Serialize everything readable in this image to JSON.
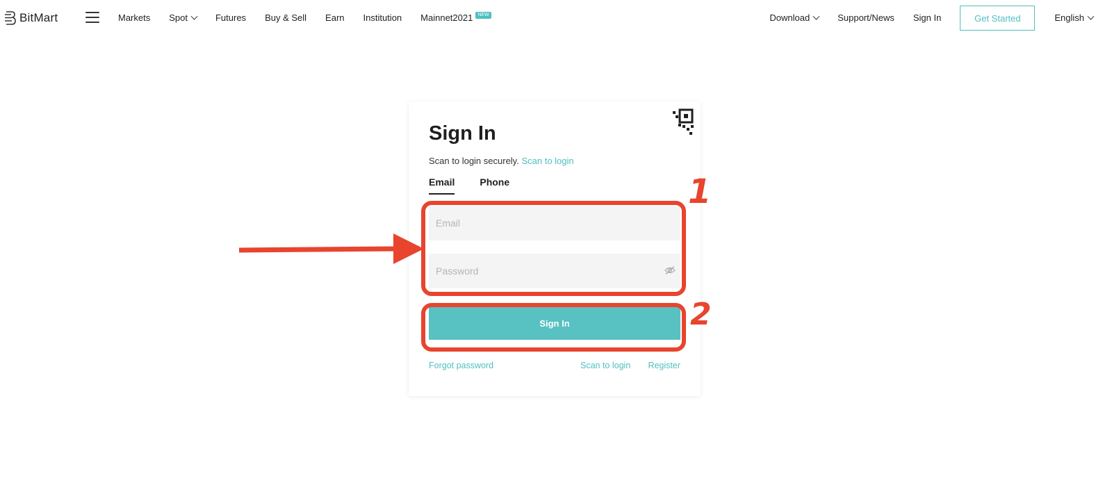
{
  "header": {
    "brand": "BitMart",
    "nav_left": [
      {
        "label": "Markets"
      },
      {
        "label": "Spot",
        "dropdown": true
      },
      {
        "label": "Futures"
      },
      {
        "label": "Buy & Sell"
      },
      {
        "label": "Earn"
      },
      {
        "label": "Institution"
      },
      {
        "label": "Mainnet2021",
        "badge": "NEW"
      }
    ],
    "nav_right": {
      "download": "Download",
      "support": "Support/News",
      "sign_in": "Sign In",
      "get_started": "Get Started",
      "language": "English"
    }
  },
  "signin": {
    "title": "Sign In",
    "scan_prefix": "Scan to login securely.",
    "scan_link": "Scan to login",
    "tabs": [
      "Email",
      "Phone"
    ],
    "active_tab": "Email",
    "email_placeholder": "Email",
    "password_placeholder": "Password",
    "submit_label": "Sign In",
    "forgot_password": "Forgot password",
    "scan_to_login": "Scan to login",
    "register": "Register"
  },
  "annotations": {
    "label_1": "1",
    "label_2": "2"
  },
  "colors": {
    "accent": "#4fbfc0",
    "button": "#58c1c2",
    "annotation": "#e8442e"
  },
  "icons": {
    "brand": "bitmart-logo-icon",
    "menu": "hamburger-icon",
    "dropdown": "chevron-down-icon",
    "qr": "qr-code-icon",
    "password_toggle": "eye-icon"
  }
}
